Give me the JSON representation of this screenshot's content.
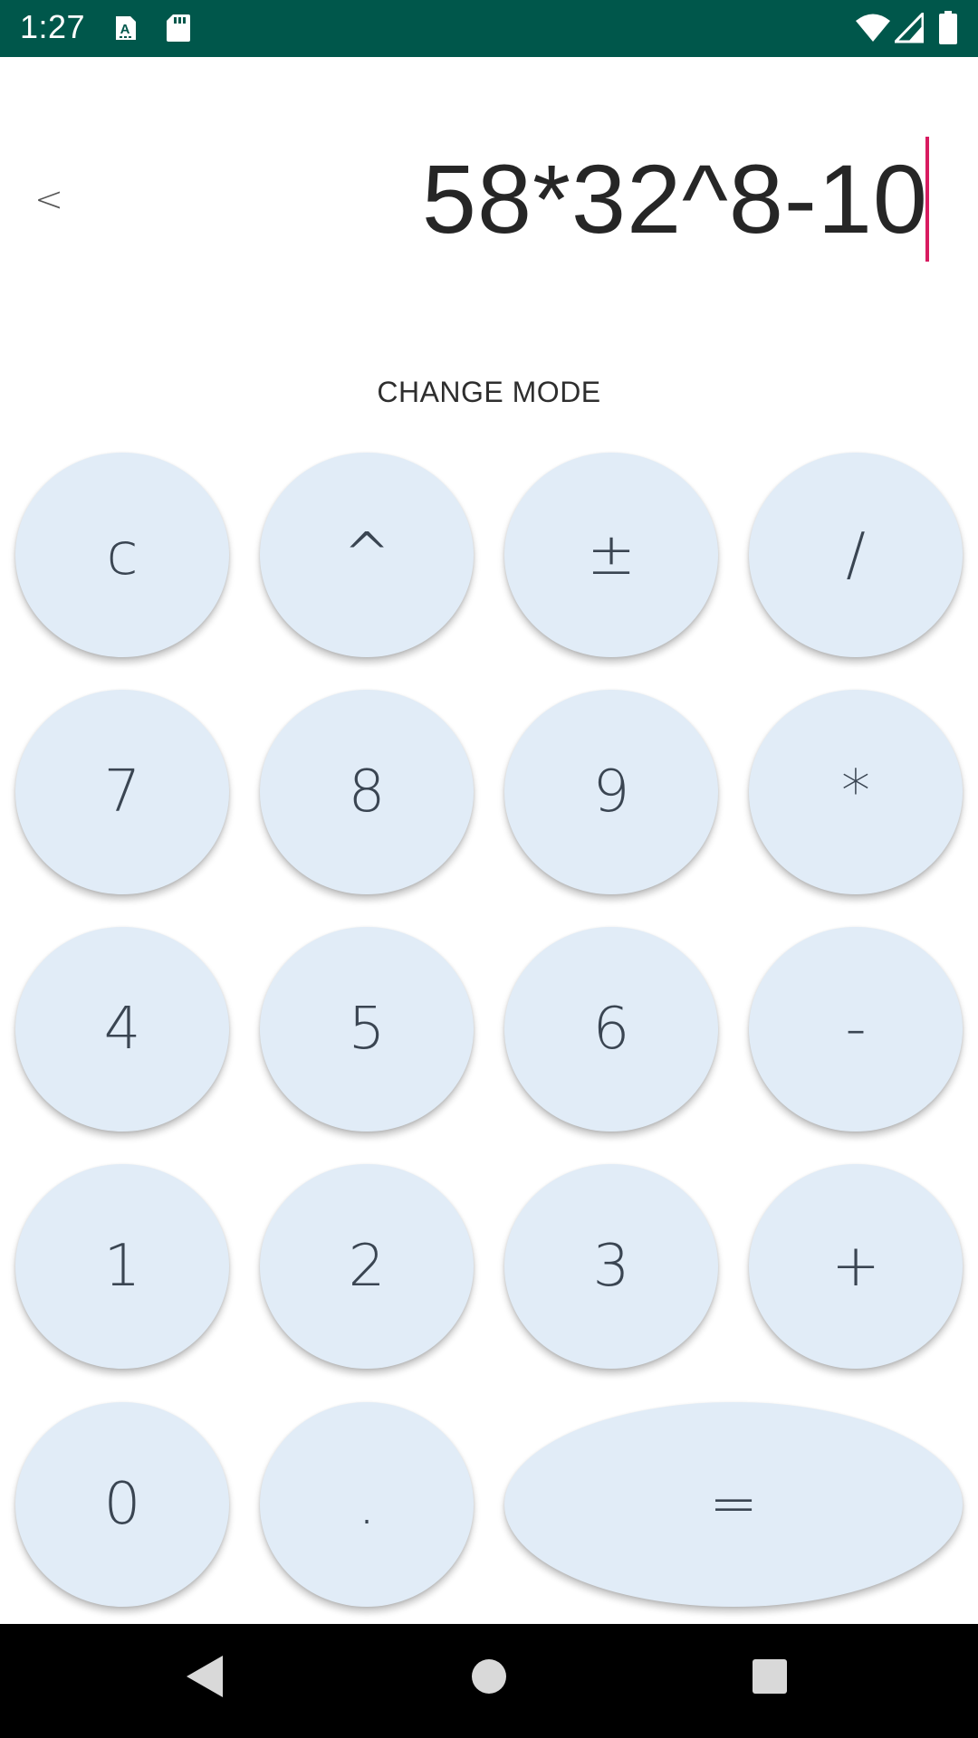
{
  "status_bar": {
    "time": "1:27",
    "background": "#00574b",
    "icons": [
      "sim-a-icon",
      "sd-card-icon",
      "wifi-icon",
      "signal-icon",
      "battery-icon"
    ]
  },
  "display": {
    "back_label": "<",
    "expression": "58*32^8-10",
    "cursor_color": "#d81b60"
  },
  "mode_button": {
    "label": "CHANGE MODE"
  },
  "keypad": {
    "key_color": "#e1ecf7",
    "rows": [
      [
        {
          "label": "c",
          "name": "clear-key"
        },
        {
          "label": "^",
          "name": "power-key"
        },
        {
          "label": "±",
          "name": "negate-key"
        },
        {
          "label": "/",
          "name": "divide-key"
        }
      ],
      [
        {
          "label": "7",
          "name": "digit-7-key"
        },
        {
          "label": "8",
          "name": "digit-8-key"
        },
        {
          "label": "9",
          "name": "digit-9-key"
        },
        {
          "label": "*",
          "name": "multiply-key"
        }
      ],
      [
        {
          "label": "4",
          "name": "digit-4-key"
        },
        {
          "label": "5",
          "name": "digit-5-key"
        },
        {
          "label": "6",
          "name": "digit-6-key"
        },
        {
          "label": "-",
          "name": "minus-key"
        }
      ],
      [
        {
          "label": "1",
          "name": "digit-1-key"
        },
        {
          "label": "2",
          "name": "digit-2-key"
        },
        {
          "label": "3",
          "name": "digit-3-key"
        },
        {
          "label": "+",
          "name": "plus-key"
        }
      ],
      [
        {
          "label": "0",
          "name": "digit-0-key"
        },
        {
          "label": ".",
          "name": "decimal-key"
        },
        {
          "label": "=",
          "name": "equals-key"
        }
      ]
    ]
  },
  "nav_bar": {
    "icons": [
      "back-nav-icon",
      "home-nav-icon",
      "recents-nav-icon"
    ]
  }
}
